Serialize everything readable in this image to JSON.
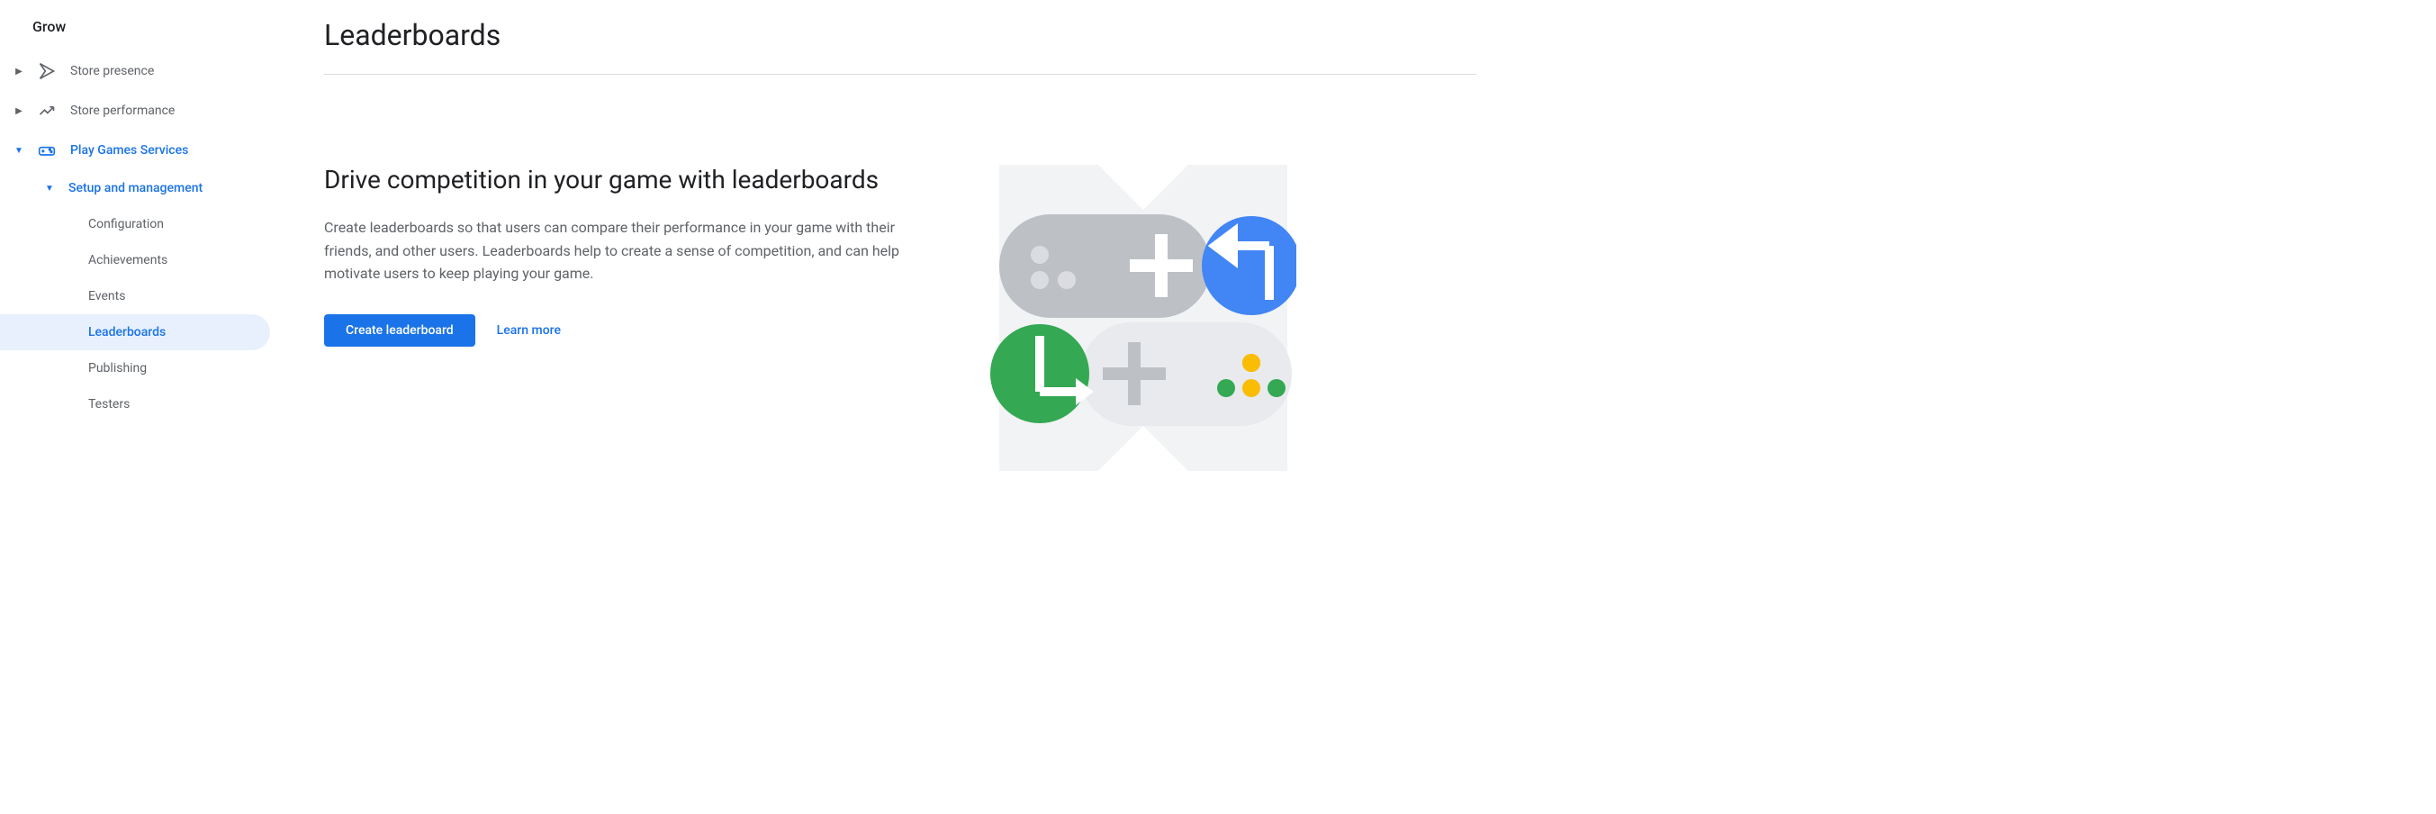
{
  "sidebar": {
    "section": "Grow",
    "items": [
      {
        "label": "Store presence",
        "icon": "play-icon",
        "expandable": true
      },
      {
        "label": "Store performance",
        "icon": "chart-icon",
        "expandable": true
      },
      {
        "label": "Play Games Services",
        "icon": "controller-icon",
        "expandable": true,
        "expanded": true
      },
      {
        "label": "Setup and management",
        "level": 2,
        "expandable": true,
        "expanded": true
      },
      {
        "label": "Configuration",
        "level": 3
      },
      {
        "label": "Achievements",
        "level": 3
      },
      {
        "label": "Events",
        "level": 3
      },
      {
        "label": "Leaderboards",
        "level": 3,
        "active": true
      },
      {
        "label": "Publishing",
        "level": 3
      },
      {
        "label": "Testers",
        "level": 3
      }
    ]
  },
  "main": {
    "title": "Leaderboards",
    "subtitle": "Drive competition in your game with leaderboards",
    "description": "Create leaderboards so that users can compare their performance in your game with their friends, and other users. Leaderboards help to create a sense of competition, and can help motivate users to keep playing your game.",
    "primary_button": "Create leaderboard",
    "link": "Learn more"
  }
}
